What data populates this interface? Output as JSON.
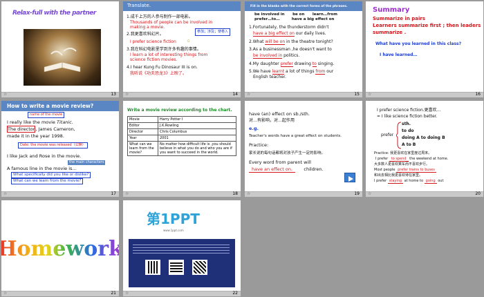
{
  "s13": {
    "num": "13",
    "title": "Relax-full with the partner"
  },
  "s14": {
    "num": "14",
    "title": "Translate.",
    "lines": [
      "1.成千上万的人参与制作一部电影。",
      "Thousands of people can be involved in",
      "making a movie.",
      "2.我更喜欢科幻片。",
      "参加；涉及；使卷入",
      "I prefer science fiction",
      "3.我在科幻电影里学到许多有趣的事情。",
      "I learn a lot of interesting things from",
      "science fiction movies.",
      "4.I hear Kung Fu Dinosaur III is on.",
      "我听说《功夫恐龙3》上映了。"
    ]
  },
  "s15": {
    "num": "15",
    "header": "Fill in the blanks with the correct forms of the phrases.",
    "phrases": [
      "be involved in      be on      learn…from",
      "prefer…to…         have a big effect on"
    ],
    "q1": "1.Fortunately, the thunderstorm didn't",
    "a1": "have a big effect on",
    "q1b": "our daily lives.",
    "q2": "2.What",
    "a2": "will be on",
    "q2b": "in the theatre tonight?",
    "q3": "3.As a businessman ,he doesn't want to",
    "a3": "be involved in",
    "q3b": "politics.",
    "q4": "4.My daughter",
    "a4a": "prefer",
    "q4b": "drawing",
    "a4b": "to",
    "q4c": "singing.",
    "q5": "5.We have",
    "a5a": "learnt",
    "q5b": "a lot of things",
    "a5b": "from",
    "q5c": "our",
    "q5d": "English teacher."
  },
  "s16": {
    "num": "16",
    "title": "Summary",
    "sub": "Summarize in pairs",
    "sub2": "Learners summarize first ; then leaders",
    "sub3": "summarize .",
    "q": "What have you learned in this class?",
    "a": "I have learned…"
  },
  "s17": {
    "num": "17",
    "title": "How to write a movie review?",
    "lbl1": "name of the movie",
    "l1a": "I really like the movie ",
    "l1b": "Titanic.",
    "l2a": "The director",
    "l2b": ", James Cameron,",
    "l3": "made it in the year 1998.",
    "lbl2": "Date: the movie was released（公映）",
    "l4": "I like Jack and Rose in the movie.",
    "lbl3": "the main characters",
    "l5": "A famous line in the movie is…",
    "b1": "What specifically did you like or dislike?",
    "b2": "What can we learn from the movie?"
  },
  "s18": {
    "num": "18",
    "title": "Write a movie review according to the chart.",
    "rows": [
      [
        "Movie",
        "Harry Potter  I"
      ],
      [
        "Editor",
        "J.K.Rowling"
      ],
      [
        "Director",
        "Chris  Columbus"
      ],
      [
        "Year",
        "2001"
      ],
      [
        "What can we learn from the movie?",
        "No matter how difficult life is ,you should believe in what you do and who you are if you want to succeed in the world."
      ]
    ]
  },
  "s19": {
    "num": "19",
    "l1": "have  (an) effect on sb./sth.",
    "l2": "对…有影响，对…起作用",
    "eg": "e.g.",
    "l3": "Teacher's words have a great effect on students.",
    "pr": "Practice:",
    "l4": "家长说的每句话都将对孩子产生一定的影响。",
    "l5": "Every word from parent will",
    "ans": "have an effect on.",
    "l6": "children."
  },
  "s20": {
    "num": "20",
    "l1": "I prefer  science fiction.更喜欢…",
    "l2": "= I like science fiction better.",
    "pref": "prefer",
    "o1": "sth.",
    "o2": "to do",
    "o3": "doing A  to doing B",
    "o4": "A to B",
    "pr": "Practice: 我更喜欢在家里度过周末。",
    "p1a": "I prefer",
    "p1b": "to spend",
    "p1c": "the weekend at home.",
    "p2": "大多数人更喜欢乘车而不喜欢步行。",
    "p3a": "Most people",
    "p3b": "prefer trains to buses",
    "p4": "和出去相比我更喜欢待在家里。",
    "p5a": "I prefer",
    "p5b": "staying",
    "p5c": "at home to",
    "p5d": "going",
    "p5e": "out"
  },
  "s21": {
    "num": "21",
    "title": "Homework"
  },
  "s22": {
    "num": "22",
    "brand": "第1PPT",
    "site": "www.1ppt.com"
  }
}
